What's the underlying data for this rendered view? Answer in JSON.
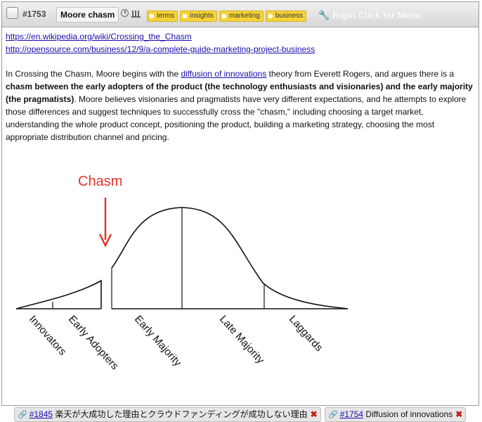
{
  "header": {
    "id": "#1753",
    "title": "Moore chasm",
    "tags": [
      "terms",
      "insights",
      "marketing",
      "business"
    ],
    "menu_hint": "Right Click for Menu"
  },
  "links": [
    "https://en.wikipedia.org/wiki/Crossing_the_Chasm",
    "http://opensource.com/business/12/9/a-complete-guide-marketing-project-business"
  ],
  "paragraph": {
    "p1": "In Crossing the Chasm, Moore begins with the ",
    "link": "diffusion of innovations",
    "p2": "  theory from Everett Rogers, and argues there is a ",
    "bold": "chasm between the early adopters of the product (the technology enthusiasts and visionaries) and the early majority (the pragmatists)",
    "p3": ". Moore believes visionaries and pragmatists have very different expectations, and he attempts to explore those differences and suggest techniques to successfully cross the \"chasm,\" including choosing a target market, understanding the whole product concept, positioning the product, building a marketing strategy, choosing the most appropriate distribution channel and pricing."
  },
  "figure": {
    "chasm_label": "Chasm",
    "segments": [
      "Innovators",
      "Early Adopters",
      "Early Majority",
      "Late Majority",
      "Laggards"
    ],
    "colors": {
      "chasm": "#e0352a",
      "curve": "#111111"
    }
  },
  "backlinks": [
    {
      "id": "#1845",
      "title": "楽天が大成功した理由とクラウドファンディングが成功しない理由"
    },
    {
      "id": "#1754",
      "title": "Diffusion of innovations"
    }
  ]
}
